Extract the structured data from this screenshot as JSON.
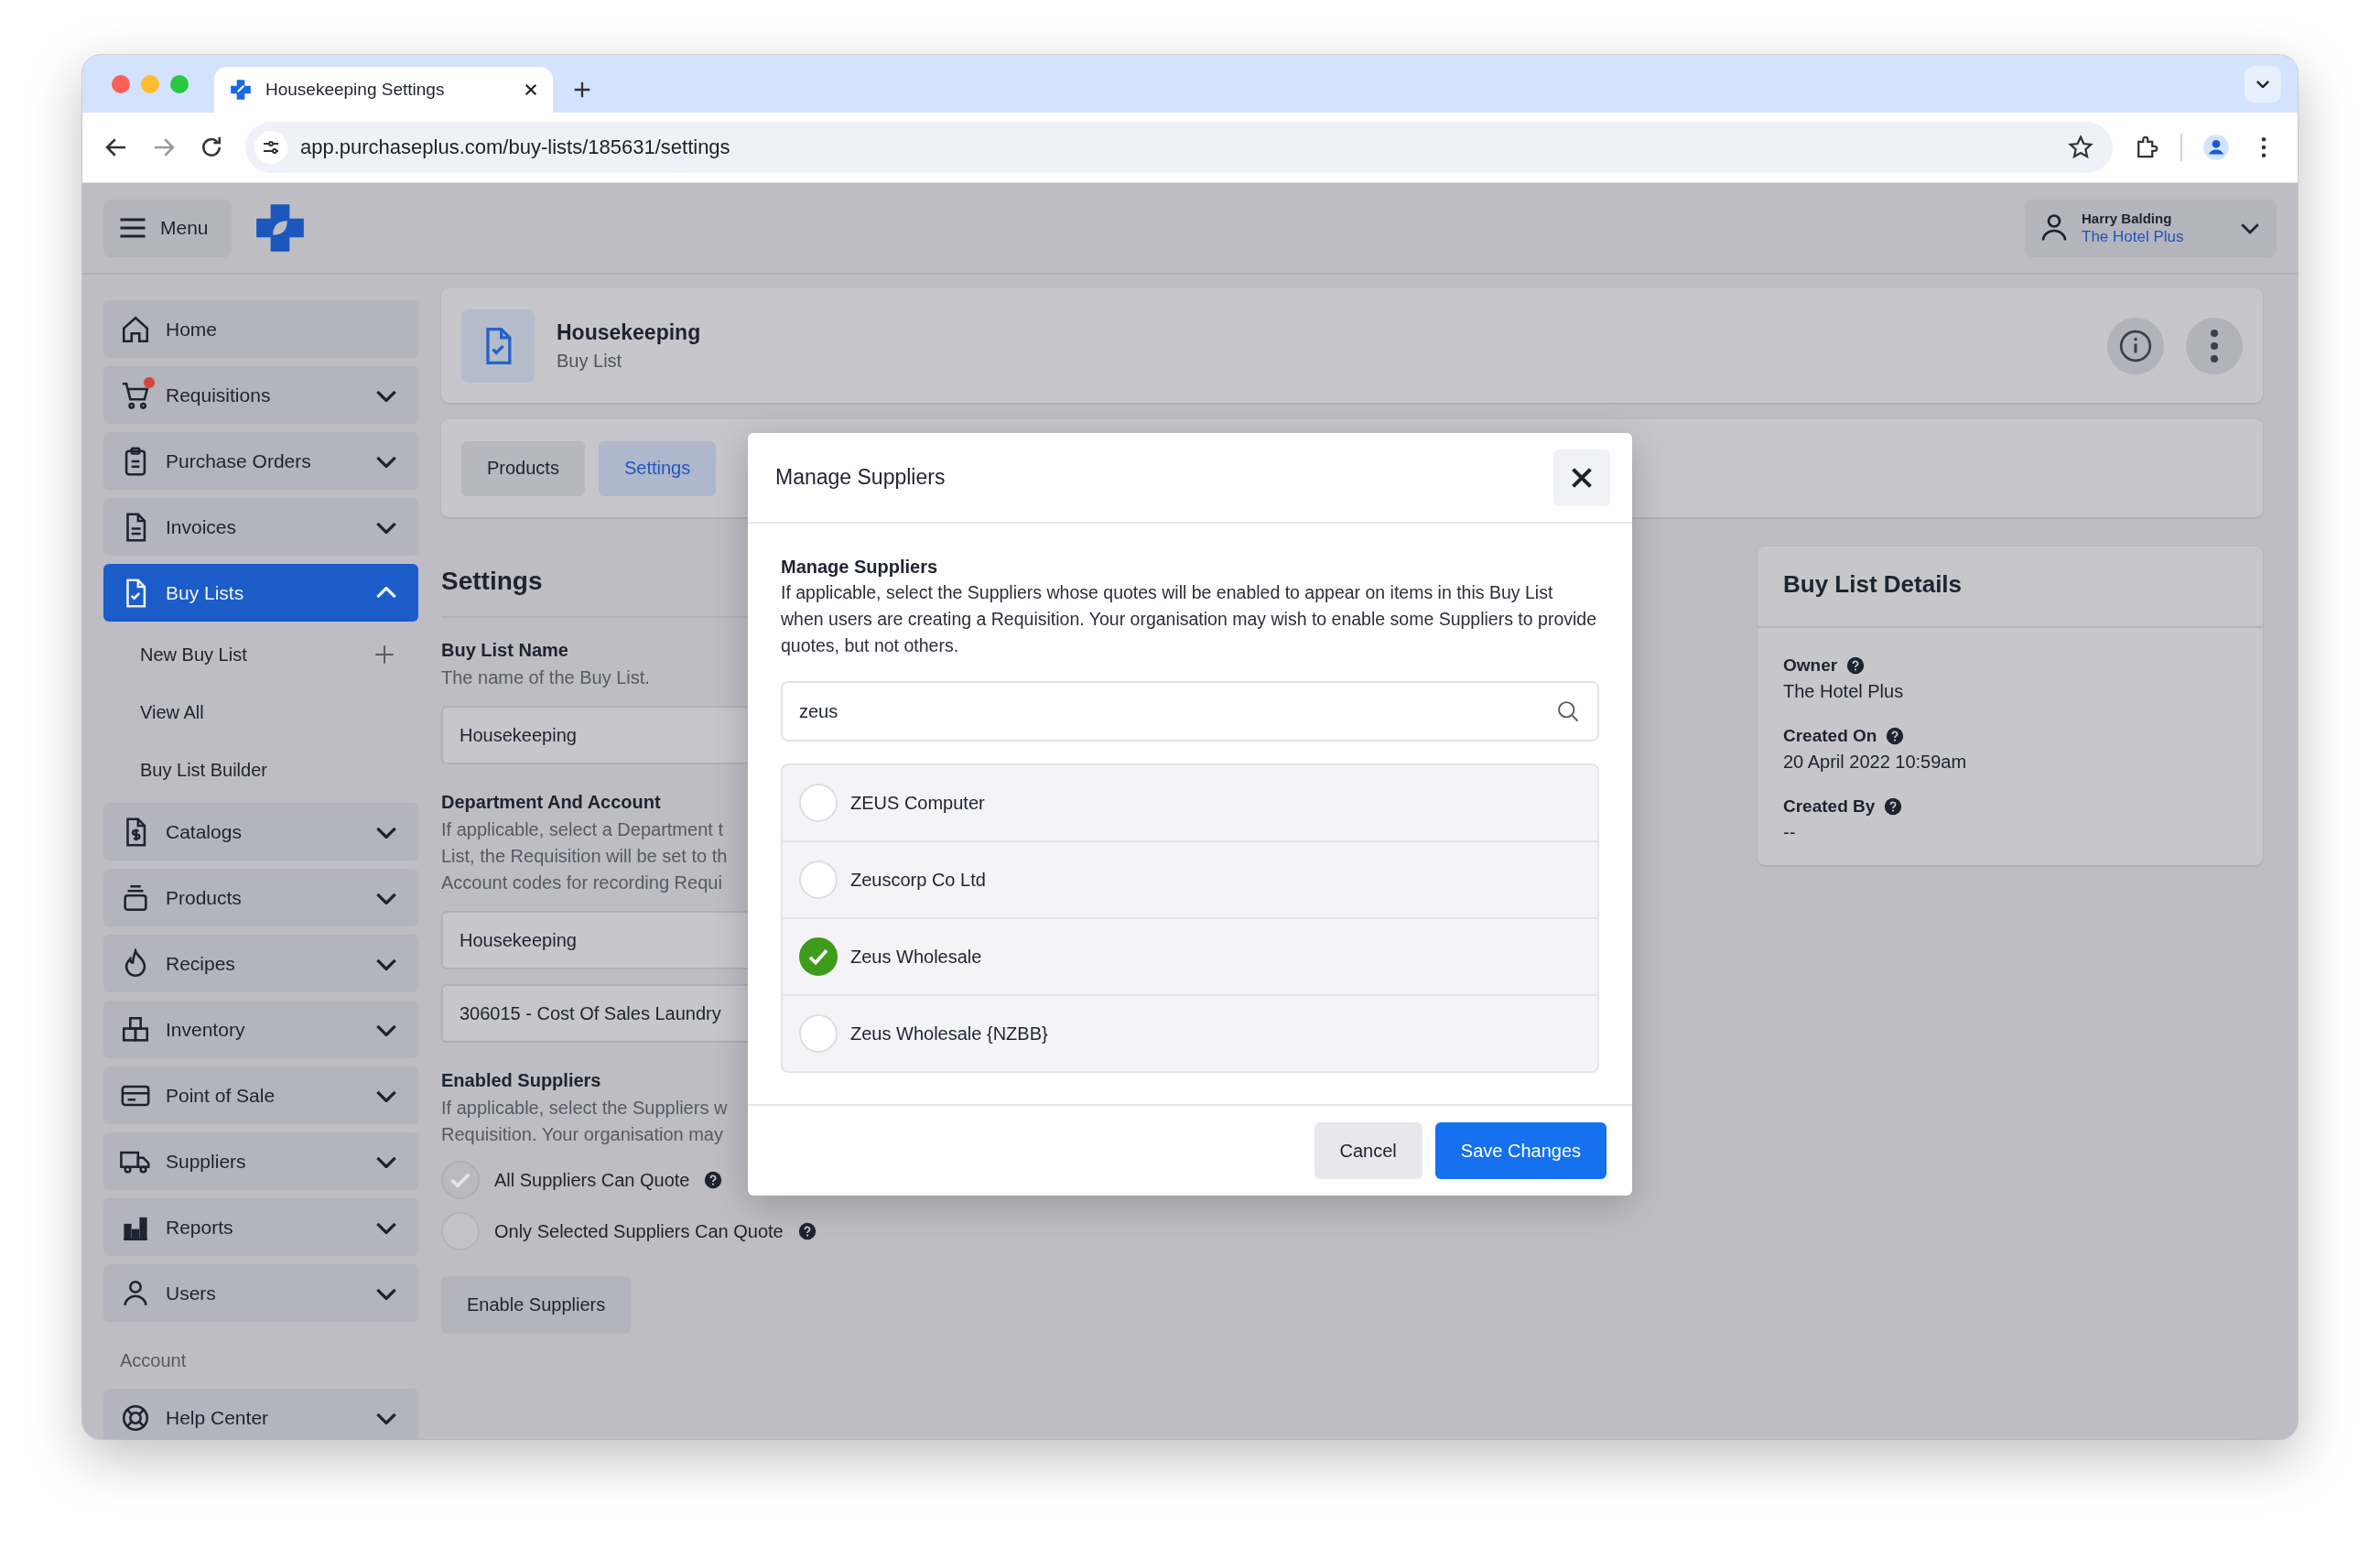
{
  "browser": {
    "tab_title": "Housekeeping Settings",
    "url": "app.purchaseplus.com/buy-lists/185631/settings"
  },
  "header": {
    "menu_label": "Menu",
    "user": {
      "name": "Harry Balding",
      "organisation": "The Hotel Plus"
    }
  },
  "sidebar": {
    "items": [
      {
        "label": "Home",
        "has_chevron": false,
        "selected": false,
        "notification": false
      },
      {
        "label": "Requisitions",
        "has_chevron": true,
        "expanded": false,
        "selected": false,
        "notification": true
      },
      {
        "label": "Purchase Orders",
        "has_chevron": true,
        "expanded": false,
        "selected": false,
        "notification": false
      },
      {
        "label": "Invoices",
        "has_chevron": true,
        "expanded": false,
        "selected": false,
        "notification": false
      },
      {
        "label": "Buy Lists",
        "has_chevron": true,
        "expanded": true,
        "selected": true,
        "notification": false,
        "children": [
          {
            "label": "New Buy List",
            "has_add": true
          },
          {
            "label": "View All",
            "has_add": false
          },
          {
            "label": "Buy List Builder",
            "has_add": false
          }
        ]
      },
      {
        "label": "Catalogs",
        "has_chevron": true,
        "expanded": false,
        "selected": false,
        "notification": false
      },
      {
        "label": "Products",
        "has_chevron": true,
        "expanded": false,
        "selected": false,
        "notification": false
      },
      {
        "label": "Recipes",
        "has_chevron": true,
        "expanded": false,
        "selected": false,
        "notification": false
      },
      {
        "label": "Inventory",
        "has_chevron": true,
        "expanded": false,
        "selected": false,
        "notification": false
      },
      {
        "label": "Point of Sale",
        "has_chevron": true,
        "expanded": false,
        "selected": false,
        "notification": false
      },
      {
        "label": "Suppliers",
        "has_chevron": true,
        "expanded": false,
        "selected": false,
        "notification": false
      },
      {
        "label": "Reports",
        "has_chevron": true,
        "expanded": false,
        "selected": false,
        "notification": false
      },
      {
        "label": "Users",
        "has_chevron": true,
        "expanded": false,
        "selected": false,
        "notification": false
      }
    ],
    "section_label": "Account",
    "account_items": [
      {
        "label": "Help Center",
        "expanded": false
      }
    ]
  },
  "page": {
    "title": "Housekeeping",
    "subtitle": "Buy List"
  },
  "tabs": [
    {
      "label": "Products",
      "selected": false
    },
    {
      "label": "Settings",
      "selected": true
    }
  ],
  "settings": {
    "heading": "Settings",
    "sections": [
      {
        "title": "Buy List Name",
        "description_lines": [
          "The name of the Buy List."
        ],
        "inputs": [
          "Housekeeping"
        ]
      },
      {
        "title": "Department And Account",
        "description_lines": [
          "If applicable, select a Department t",
          "List, the Requisition will be set to th",
          "Account codes for recording Requi"
        ],
        "inputs": [
          "Housekeeping",
          "306015 - Cost Of Sales Laundry"
        ]
      },
      {
        "title": "Enabled Suppliers",
        "description_lines": [
          "If applicable, select the Suppliers w",
          "Requisition. Your organisation may"
        ],
        "options": [
          {
            "label": "All Suppliers Can Quote",
            "checked": true
          },
          {
            "label": "Only Selected Suppliers Can Quote",
            "checked": false
          }
        ],
        "button": "Enable Suppliers"
      }
    ]
  },
  "details": {
    "title": "Buy List Details",
    "fields": [
      {
        "label": "Owner",
        "value": "The Hotel Plus"
      },
      {
        "label": "Created On",
        "value": "20 April 2022 10:59am"
      },
      {
        "label": "Created By",
        "value": "--"
      }
    ]
  },
  "modal": {
    "title": "Manage Suppliers",
    "section_title": "Manage Suppliers",
    "description": "If applicable, select the Suppliers whose quotes will be enabled to appear on items in this Buy List when users are creating a Requisition. Your organisation may wish to enable some Suppliers to provide quotes, but not others.",
    "search": {
      "value": "zeus"
    },
    "suppliers": [
      {
        "name": "ZEUS Computer",
        "selected": false
      },
      {
        "name": "Zeuscorp Co Ltd",
        "selected": false
      },
      {
        "name": "Zeus Wholesale",
        "selected": true
      },
      {
        "name": "Zeus Wholesale {NZBB}",
        "selected": false
      }
    ],
    "buttons": [
      {
        "label": "Cancel",
        "kind": "secondary"
      },
      {
        "label": "Save Changes",
        "kind": "primary"
      }
    ]
  }
}
